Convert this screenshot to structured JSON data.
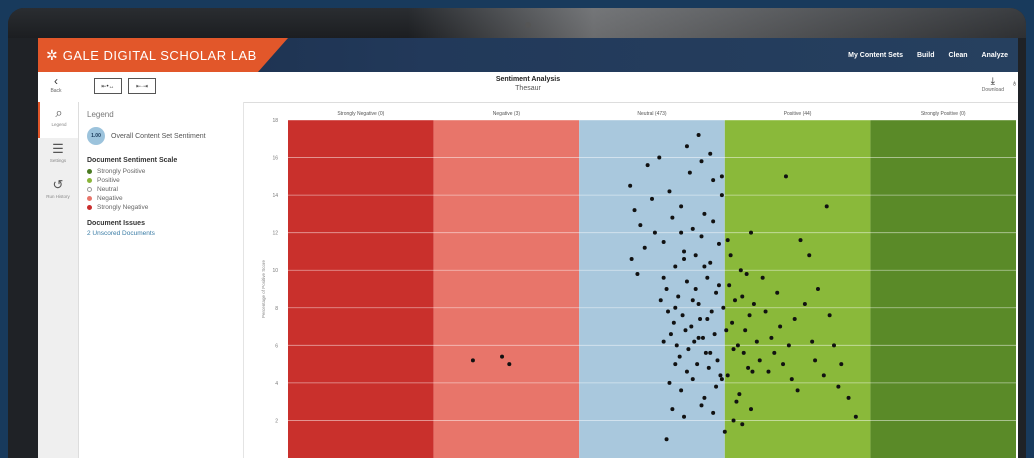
{
  "header": {
    "brand": "GALE DIGITAL SCHOLAR LAB",
    "logo_icon": "gale-logo-icon",
    "nav": [
      "My Content Sets",
      "Build",
      "Clean",
      "Analyze"
    ]
  },
  "toolbar": {
    "back_label": "Back",
    "title": "Sentiment Analysis",
    "subtitle": "Thesaur",
    "download_label": "Download"
  },
  "rail": [
    {
      "label": "Legend",
      "icon": "search-icon"
    },
    {
      "label": "Settings",
      "icon": "sliders-icon"
    },
    {
      "label": "Run History",
      "icon": "history-icon"
    }
  ],
  "legend": {
    "heading": "Legend",
    "overall_value": "1.00",
    "overall_label": "Overall Content Set Sentiment",
    "scale_title": "Document Sentiment Scale",
    "scale": [
      {
        "label": "Strongly Positive",
        "color": "#4a7a22"
      },
      {
        "label": "Positive",
        "color": "#8ab53a"
      },
      {
        "label": "Neutral",
        "color": "#ffffff"
      },
      {
        "label": "Negative",
        "color": "#e8756a"
      },
      {
        "label": "Strongly Negative",
        "color": "#c92d2d"
      }
    ],
    "issues_title": "Document Issues",
    "issues_link": "2 Unscored Documents"
  },
  "chart_data": {
    "type": "scatter",
    "ylabel": "Percentage of Positive Score",
    "ylim": [
      0,
      18
    ],
    "yticks": [
      2,
      4,
      6,
      8,
      10,
      12,
      14,
      16,
      18
    ],
    "bands": [
      {
        "label": "Strongly Negative (0)",
        "color": "#c9302c"
      },
      {
        "label": "Negative (3)",
        "color": "#e8756a"
      },
      {
        "label": "Neutral (473)",
        "color": "#a9c8dd"
      },
      {
        "label": "Positive (44)",
        "color": "#8ab93a"
      },
      {
        "label": "Strongly Positive (0)",
        "color": "#5a8a28"
      }
    ],
    "points": [
      [
        1.27,
        5.2
      ],
      [
        1.47,
        5.4
      ],
      [
        1.52,
        5.0
      ],
      [
        2.35,
        14.5
      ],
      [
        2.38,
        13.2
      ],
      [
        2.42,
        12.4
      ],
      [
        2.47,
        15.6
      ],
      [
        2.4,
        9.8
      ],
      [
        2.45,
        11.2
      ],
      [
        2.5,
        13.8
      ],
      [
        2.36,
        10.6
      ],
      [
        2.52,
        12.0
      ],
      [
        2.55,
        16.0
      ],
      [
        2.58,
        11.5
      ],
      [
        2.6,
        9.0
      ],
      [
        2.62,
        14.2
      ],
      [
        2.64,
        12.8
      ],
      [
        2.66,
        10.2
      ],
      [
        2.68,
        8.6
      ],
      [
        2.7,
        13.4
      ],
      [
        2.72,
        11.0
      ],
      [
        2.74,
        9.4
      ],
      [
        2.76,
        15.2
      ],
      [
        2.78,
        12.2
      ],
      [
        2.8,
        10.8
      ],
      [
        2.82,
        8.2
      ],
      [
        2.84,
        11.8
      ],
      [
        2.86,
        13.0
      ],
      [
        2.88,
        9.6
      ],
      [
        2.9,
        10.4
      ],
      [
        2.92,
        12.6
      ],
      [
        2.94,
        8.8
      ],
      [
        2.96,
        11.4
      ],
      [
        2.98,
        14.0
      ],
      [
        2.61,
        7.8
      ],
      [
        2.63,
        6.6
      ],
      [
        2.65,
        7.2
      ],
      [
        2.67,
        6.0
      ],
      [
        2.69,
        5.4
      ],
      [
        2.71,
        7.6
      ],
      [
        2.73,
        6.8
      ],
      [
        2.75,
        5.8
      ],
      [
        2.77,
        7.0
      ],
      [
        2.79,
        6.2
      ],
      [
        2.81,
        5.0
      ],
      [
        2.83,
        7.4
      ],
      [
        2.85,
        6.4
      ],
      [
        2.87,
        5.6
      ],
      [
        2.89,
        4.8
      ],
      [
        2.91,
        7.8
      ],
      [
        2.93,
        6.6
      ],
      [
        2.95,
        5.2
      ],
      [
        2.97,
        4.4
      ],
      [
        2.99,
        8.0
      ],
      [
        3.01,
        6.8
      ],
      [
        3.03,
        9.2
      ],
      [
        3.05,
        7.2
      ],
      [
        3.07,
        8.4
      ],
      [
        3.09,
        6.0
      ],
      [
        3.11,
        10.0
      ],
      [
        3.13,
        5.6
      ],
      [
        3.15,
        9.8
      ],
      [
        3.17,
        7.6
      ],
      [
        3.19,
        4.6
      ],
      [
        2.62,
        4.0
      ],
      [
        2.7,
        3.6
      ],
      [
        2.78,
        4.2
      ],
      [
        2.86,
        3.2
      ],
      [
        2.94,
        3.8
      ],
      [
        3.02,
        4.4
      ],
      [
        3.1,
        3.4
      ],
      [
        2.56,
        8.4
      ],
      [
        2.58,
        9.6
      ],
      [
        2.66,
        8.0
      ],
      [
        2.72,
        10.6
      ],
      [
        2.8,
        9.0
      ],
      [
        2.88,
        7.4
      ],
      [
        2.96,
        9.2
      ],
      [
        3.04,
        10.8
      ],
      [
        3.12,
        8.6
      ],
      [
        3.18,
        12.0
      ],
      [
        2.74,
        16.6
      ],
      [
        2.82,
        17.2
      ],
      [
        2.9,
        16.2
      ],
      [
        2.98,
        15.0
      ],
      [
        2.64,
        2.6
      ],
      [
        2.72,
        2.2
      ],
      [
        2.84,
        2.8
      ],
      [
        2.92,
        2.4
      ],
      [
        3.0,
        1.4
      ],
      [
        3.06,
        2.0
      ],
      [
        2.6,
        1.0
      ],
      [
        2.58,
        6.2
      ],
      [
        2.66,
        5.0
      ],
      [
        2.74,
        4.6
      ],
      [
        2.82,
        6.4
      ],
      [
        2.9,
        5.6
      ],
      [
        2.98,
        4.2
      ],
      [
        3.06,
        5.8
      ],
      [
        3.14,
        6.8
      ],
      [
        3.08,
        3.0
      ],
      [
        3.16,
        4.8
      ],
      [
        3.02,
        11.6
      ],
      [
        2.92,
        14.8
      ],
      [
        2.84,
        15.8
      ],
      [
        2.7,
        12.0
      ],
      [
        2.78,
        8.4
      ],
      [
        2.86,
        10.2
      ],
      [
        3.12,
        1.8
      ],
      [
        3.18,
        2.6
      ],
      [
        3.2,
        8.2
      ],
      [
        3.22,
        6.2
      ],
      [
        3.24,
        5.2
      ],
      [
        3.26,
        9.6
      ],
      [
        3.28,
        7.8
      ],
      [
        3.3,
        4.6
      ],
      [
        3.32,
        6.4
      ],
      [
        3.34,
        5.6
      ],
      [
        3.36,
        8.8
      ],
      [
        3.38,
        7.0
      ],
      [
        3.4,
        5.0
      ],
      [
        3.44,
        6.0
      ],
      [
        3.46,
        4.2
      ],
      [
        3.48,
        7.4
      ],
      [
        3.5,
        3.6
      ],
      [
        3.55,
        8.2
      ],
      [
        3.6,
        6.2
      ],
      [
        3.62,
        5.2
      ],
      [
        3.68,
        4.4
      ],
      [
        3.72,
        7.6
      ],
      [
        3.75,
        6.0
      ],
      [
        3.8,
        5.0
      ],
      [
        3.85,
        3.2
      ],
      [
        3.9,
        2.2
      ],
      [
        3.42,
        15.0
      ],
      [
        3.52,
        11.6
      ],
      [
        3.58,
        10.8
      ],
      [
        3.7,
        13.4
      ],
      [
        3.64,
        9.0
      ],
      [
        3.78,
        3.8
      ]
    ]
  }
}
